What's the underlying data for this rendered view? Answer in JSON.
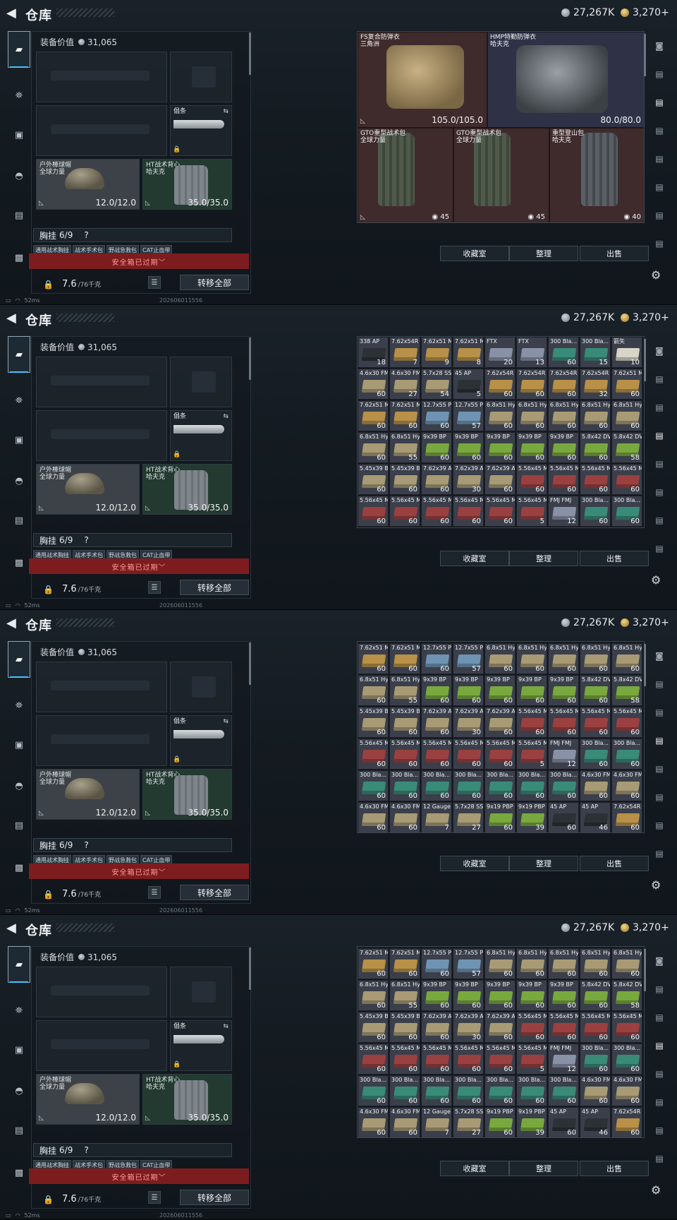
{
  "header": {
    "title": "仓库",
    "currency_silver": "27,267K",
    "currency_gold": "3,270",
    "plus": "+"
  },
  "equipment": {
    "value_label": "装备价值",
    "value": "31,065",
    "melee_label": "倡条",
    "helmet": {
      "name": "户外棒球帽",
      "maker": "全球力量",
      "durability": "12.0/12.0"
    },
    "vest": {
      "name": "HT战术背心",
      "maker": "哈夫克",
      "durability": "35.0/35.0"
    },
    "rig_label": "胸挂",
    "rig_count": "6/9",
    "rig_help": "?",
    "rig_tags": [
      "通用战术胸挂",
      "战术手术包",
      "野战急救包",
      "CAT止血带"
    ],
    "safe_box_expired": "安全箱已过期",
    "weight": "7.6",
    "weight_cap": "/76千克",
    "transfer_all": "转移全部"
  },
  "status": {
    "ping": "52ms",
    "build": "202606011556"
  },
  "armor": [
    {
      "name": "FS复合防弹衣",
      "maker": "三角洲",
      "durability": "105.0/105.0"
    },
    {
      "name": "HMP特勤防弹衣",
      "maker": "哈夫克",
      "durability": "80.0/80.0"
    }
  ],
  "packs": [
    {
      "name": "GTO重型战术包",
      "maker": "全球力量",
      "capacity": "45"
    },
    {
      "name": "GTO重型战术包",
      "maker": "全球力量",
      "capacity": "45"
    },
    {
      "name": "重型登山包",
      "maker": "哈夫克",
      "capacity": "40"
    }
  ],
  "actions": {
    "favorites": "收藏室",
    "sort": "整理",
    "sell": "出售"
  },
  "colors": {
    "accent": "#49c0ff",
    "expired": "#7d1c1e",
    "ammo_bg": "#3a3f4b"
  },
  "ammo_rows": [
    [
      [
        "338 AP",
        "18"
      ],
      [
        "7.62x54R SNB",
        "7"
      ],
      [
        "7.62x51 M80",
        "9"
      ],
      [
        "7.62x51 M80",
        "8"
      ],
      [
        "FTX",
        "20"
      ],
      [
        "FTX",
        "13"
      ],
      [
        "300 Bla... BCP FMJ",
        "60"
      ],
      [
        "300 Bla... BCP FMJ",
        "15"
      ],
      [
        "箭矢",
        "10"
      ]
    ],
    [
      [
        "4.6x30 FMJ SX",
        "60"
      ],
      [
        "4.6x30 FMJ SX",
        "27"
      ],
      [
        "5.7x28 SS198",
        "54"
      ],
      [
        "45 AP",
        "5"
      ],
      [
        "7.62x54R LPS",
        "60"
      ],
      [
        "7.62x54R LPS",
        "60"
      ],
      [
        "7.62x54R LPS",
        "60"
      ],
      [
        "7.62x54R LPS",
        "32"
      ],
      [
        "7.62x51 M80",
        "60"
      ]
    ],
    [
      [
        "7.62x51 M80",
        "60"
      ],
      [
        "7.62x51 M80",
        "60"
      ],
      [
        "12.7x55 PS12B",
        "60"
      ],
      [
        "12.7x55 PS12B",
        "57"
      ],
      [
        "6.8x51 Hybrid",
        "60"
      ],
      [
        "6.8x51 Hybrid",
        "60"
      ],
      [
        "6.8x51 Hybrid",
        "60"
      ],
      [
        "6.8x51 Hybrid",
        "60"
      ],
      [
        "6.8x51 Hybrid",
        "60"
      ]
    ],
    [
      [
        "6.8x51 Hybrid",
        "60"
      ],
      [
        "6.8x51 Hybrid",
        "55"
      ],
      [
        "9x39 BP",
        "60"
      ],
      [
        "9x39 BP",
        "60"
      ],
      [
        "9x39 BP",
        "60"
      ],
      [
        "9x39 BP",
        "60"
      ],
      [
        "9x39 BP",
        "60"
      ],
      [
        "5.8x42 DVP88",
        "60"
      ],
      [
        "5.8x42 DVP88",
        "58"
      ]
    ],
    [
      [
        "5.45x39 BT",
        "60"
      ],
      [
        "5.45x39 BT",
        "60"
      ],
      [
        "7.62x39 AP",
        "60"
      ],
      [
        "7.62x39 AP",
        "30"
      ],
      [
        "7.62x39 AP",
        "60"
      ],
      [
        "5.56x45 M855",
        "60"
      ],
      [
        "5.56x45 M855",
        "60"
      ],
      [
        "5.56x45 M855",
        "60"
      ],
      [
        "5.56x45 M855",
        "60"
      ]
    ],
    [
      [
        "5.56x45 M995",
        "60"
      ],
      [
        "5.56x45 M995",
        "60"
      ],
      [
        "5.56x45 M995",
        "60"
      ],
      [
        "5.56x45 M995",
        "60"
      ],
      [
        "5.56x45 M995",
        "60"
      ],
      [
        "5.56x45 M995",
        "5"
      ],
      [
        "FMJ FMJ",
        "12"
      ],
      [
        "300 Bla... BCP FMJ",
        "60"
      ],
      [
        "300 Bla... BCP FMJ",
        "60"
      ]
    ],
    [
      [
        "300 Bla... BCP FMJ",
        "60"
      ],
      [
        "300 Bla... BCP FMJ",
        "60"
      ],
      [
        "300 Bla... BCP FMJ",
        "60"
      ],
      [
        "300 Bla... BCP FMJ",
        "60"
      ],
      [
        "300 Bla... BCP FMJ",
        "60"
      ],
      [
        "300 Bla... BCP FMJ",
        "60"
      ],
      [
        "300 Bla... BCP FMJ",
        "60"
      ],
      [
        "4.6x30 FMJ SX",
        "60"
      ],
      [
        "4.6x30 FMJ SX",
        "60"
      ]
    ],
    [
      [
        "4.6x30 FMJ SX",
        "60"
      ],
      [
        "4.6x30 FMJ SX",
        "60"
      ],
      [
        "12 Gauge BD",
        "7"
      ],
      [
        "5.7x28 SS190",
        "27"
      ],
      [
        "9x19 PBP",
        "60"
      ],
      [
        "9x19 PBP",
        "39"
      ],
      [
        "45 AP",
        "60"
      ],
      [
        "45 AP",
        "46"
      ],
      [
        "7.62x54R LPS",
        "60"
      ]
    ]
  ]
}
